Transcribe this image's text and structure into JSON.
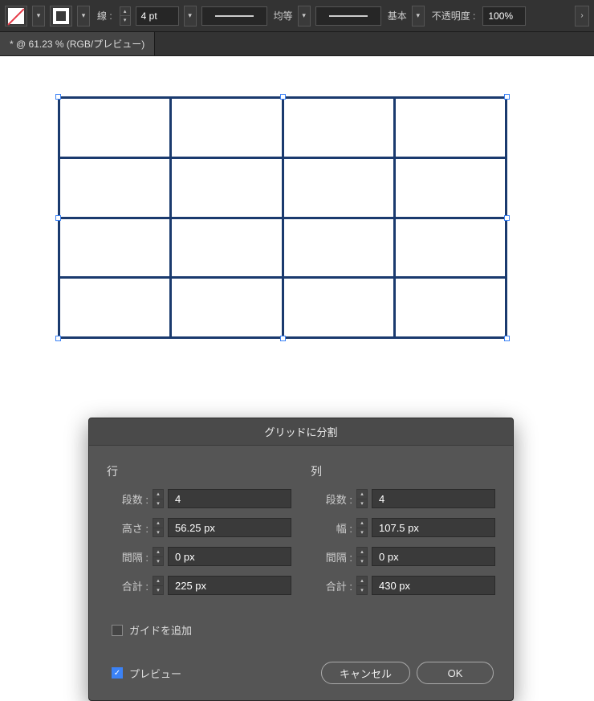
{
  "toolbar": {
    "stroke_label": "線 :",
    "stroke_weight": "4 pt",
    "profile_label": "均等",
    "brush_label": "基本",
    "opacity_label": "不透明度 :",
    "opacity_value": "100%"
  },
  "tab": {
    "title": "* @ 61.23 % (RGB/プレビュー)"
  },
  "dialog": {
    "title": "グリッドに分割",
    "row": {
      "section": "行",
      "count_label": "段数 :",
      "count": "4",
      "height_label": "高さ :",
      "height": "56.25 px",
      "gutter_label": "間隔 :",
      "gutter": "0 px",
      "total_label": "合計 :",
      "total": "225 px"
    },
    "col": {
      "section": "列",
      "count_label": "段数 :",
      "count": "4",
      "width_label": "幅 :",
      "width": "107.5 px",
      "gutter_label": "間隔 :",
      "gutter": "0 px",
      "total_label": "合計 :",
      "total": "430 px"
    },
    "add_guides_label": "ガイドを追加",
    "preview_label": "プレビュー",
    "cancel_label": "キャンセル",
    "ok_label": "OK"
  }
}
